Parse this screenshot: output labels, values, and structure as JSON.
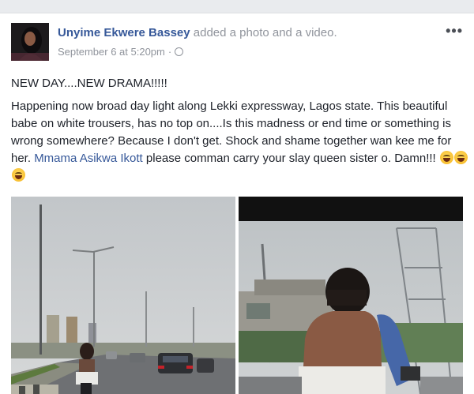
{
  "post": {
    "author": "Unyime Ekwere Bassey",
    "action": "added a photo and a video.",
    "timestamp": "September 6 at 5:20pm",
    "separator": "·",
    "privacy_icon": "globe-icon",
    "more_label": "•••",
    "headline": "NEW DAY....NEW DRAMA!!!!!",
    "body_before_mention": "Happening now broad day light along Lekki expressway, Lagos state. This beautiful babe on white trousers, has no top on....Is this madness or end time or something is wrong somewhere? Because I don't get. Shock and shame together wan kee me for her. ",
    "mention": "Mmama Asikwa Ikott",
    "body_after_mention": " please comman carry your slay queen sister o. Damn!!! ",
    "emojis": [
      "face-with-tears-of-joy-icon",
      "face-with-tears-of-joy-icon",
      "face-with-tears-of-joy-icon"
    ]
  },
  "colors": {
    "link": "#365899",
    "meta": "#90949c",
    "text": "#1d2129",
    "background": "#e9ebee"
  },
  "media": [
    {
      "kind": "photo",
      "description_icon": "photo-thumbnail"
    },
    {
      "kind": "video",
      "description_icon": "video-thumbnail"
    }
  ]
}
